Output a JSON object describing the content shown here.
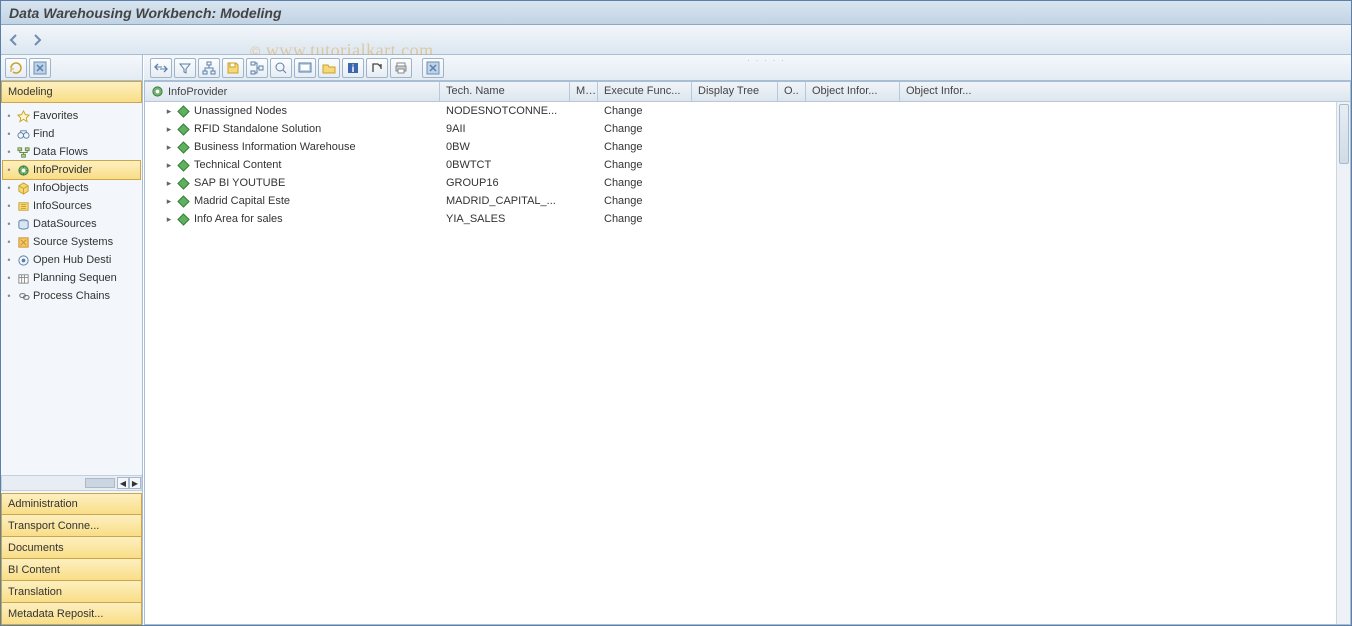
{
  "title": "Data Warehousing Workbench: Modeling",
  "watermark": "© www.tutorialkart.com",
  "sidebar": {
    "top_section": "Modeling",
    "items": [
      {
        "label": "Favorites"
      },
      {
        "label": "Find"
      },
      {
        "label": "Data Flows"
      },
      {
        "label": "InfoProvider"
      },
      {
        "label": "InfoObjects"
      },
      {
        "label": "InfoSources"
      },
      {
        "label": "DataSources"
      },
      {
        "label": "Source Systems"
      },
      {
        "label": "Open Hub Desti"
      },
      {
        "label": "Planning Sequen"
      },
      {
        "label": "Process Chains"
      }
    ],
    "bottom_sections": [
      "Administration",
      "Transport Conne...",
      "Documents",
      "BI Content",
      "Translation",
      "Metadata Reposit..."
    ]
  },
  "columns": {
    "c0": "InfoProvider",
    "c1": "Tech. Name",
    "c2": "M..",
    "c3": "Execute Func...",
    "c4": "Display Tree",
    "c5": "O..",
    "c6": "Object Infor...",
    "c7": "Object Infor..."
  },
  "rows": [
    {
      "name": "Unassigned Nodes",
      "tech": "NODESNOTCONNE...",
      "exec": "Change"
    },
    {
      "name": "RFID Standalone Solution",
      "tech": "9AII",
      "exec": "Change"
    },
    {
      "name": "Business Information Warehouse",
      "tech": "0BW",
      "exec": "Change"
    },
    {
      "name": "Technical Content",
      "tech": "0BWTCT",
      "exec": "Change"
    },
    {
      "name": "SAP BI YOUTUBE",
      "tech": "GROUP16",
      "exec": "Change"
    },
    {
      "name": "Madrid Capital Este",
      "tech": "MADRID_CAPITAL_...",
      "exec": "Change"
    },
    {
      "name": "Info Area for sales",
      "tech": "YIA_SALES",
      "exec": "Change"
    }
  ]
}
